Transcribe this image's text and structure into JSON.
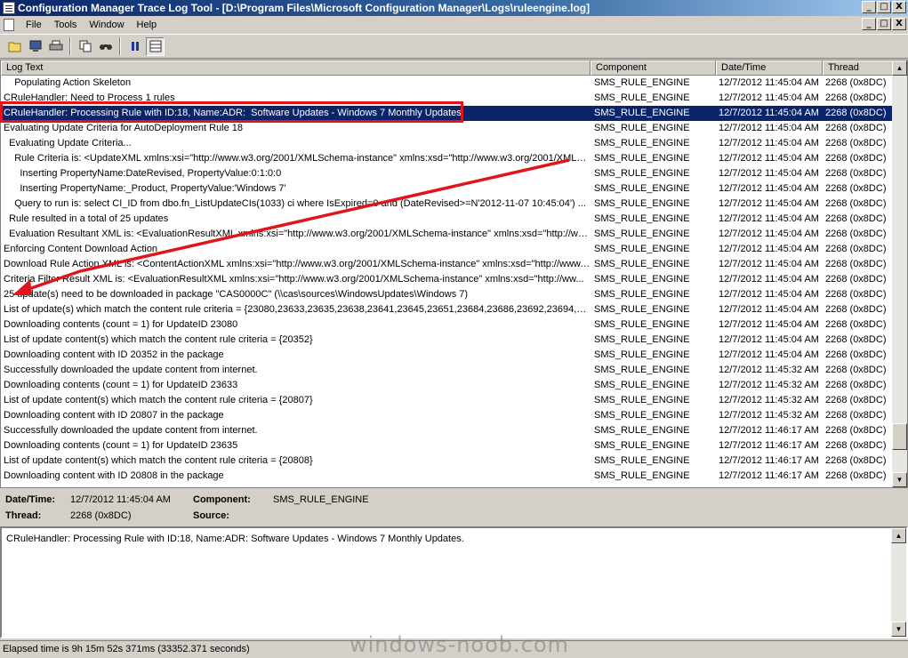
{
  "window": {
    "title": "Configuration Manager Trace Log Tool - [D:\\Program Files\\Microsoft Configuration Manager\\Logs\\ruleengine.log]",
    "minimize": "_",
    "maximize": "□",
    "close": "X"
  },
  "menu": {
    "items": [
      "File",
      "Tools",
      "Window",
      "Help"
    ]
  },
  "columns": {
    "log_text": "Log Text",
    "component": "Component",
    "datetime": "Date/Time",
    "thread": "Thread"
  },
  "rows": [
    {
      "text": "    Populating Action Skeleton",
      "component": "SMS_RULE_ENGINE",
      "datetime": "12/7/2012 11:45:04 AM",
      "thread": "2268 (0x8DC)"
    },
    {
      "text": "CRuleHandler: Need to Process 1 rules",
      "component": "SMS_RULE_ENGINE",
      "datetime": "12/7/2012 11:45:04 AM",
      "thread": "2268 (0x8DC)"
    },
    {
      "text": "CRuleHandler: Processing Rule with ID:18, Name:ADR:  Software Updates - Windows 7 Monthly Updates.",
      "component": "SMS_RULE_ENGINE",
      "datetime": "12/7/2012 11:45:04 AM",
      "thread": "2268 (0x8DC)",
      "selected": true
    },
    {
      "text": "Evaluating Update Criteria for AutoDeployment Rule 18",
      "component": "SMS_RULE_ENGINE",
      "datetime": "12/7/2012 11:45:04 AM",
      "thread": "2268 (0x8DC)"
    },
    {
      "text": "  Evaluating Update Criteria...",
      "component": "SMS_RULE_ENGINE",
      "datetime": "12/7/2012 11:45:04 AM",
      "thread": "2268 (0x8DC)"
    },
    {
      "text": "    Rule Criteria is: <UpdateXML xmlns:xsi=\"http://www.w3.org/2001/XMLSchema-instance\" xmlns:xsd=\"http://www.w3.org/2001/XMLS...",
      "component": "SMS_RULE_ENGINE",
      "datetime": "12/7/2012 11:45:04 AM",
      "thread": "2268 (0x8DC)"
    },
    {
      "text": "      Inserting PropertyName:DateRevised, PropertyValue:0:1:0:0",
      "component": "SMS_RULE_ENGINE",
      "datetime": "12/7/2012 11:45:04 AM",
      "thread": "2268 (0x8DC)"
    },
    {
      "text": "      Inserting PropertyName:_Product, PropertyValue:'Windows 7'",
      "component": "SMS_RULE_ENGINE",
      "datetime": "12/7/2012 11:45:04 AM",
      "thread": "2268 (0x8DC)"
    },
    {
      "text": "    Query to run is: select CI_ID from dbo.fn_ListUpdateCIs(1033) ci where IsExpired=0 and (DateRevised>=N'2012-11-07 10:45:04') ...",
      "component": "SMS_RULE_ENGINE",
      "datetime": "12/7/2012 11:45:04 AM",
      "thread": "2268 (0x8DC)"
    },
    {
      "text": "  Rule resulted in a total of 25 updates",
      "component": "SMS_RULE_ENGINE",
      "datetime": "12/7/2012 11:45:04 AM",
      "thread": "2268 (0x8DC)"
    },
    {
      "text": "  Evaluation Resultant XML is: <EvaluationResultXML xmlns:xsi=\"http://www.w3.org/2001/XMLSchema-instance\" xmlns:xsd=\"http://ww...",
      "component": "SMS_RULE_ENGINE",
      "datetime": "12/7/2012 11:45:04 AM",
      "thread": "2268 (0x8DC)"
    },
    {
      "text": "Enforcing Content Download Action",
      "component": "SMS_RULE_ENGINE",
      "datetime": "12/7/2012 11:45:04 AM",
      "thread": "2268 (0x8DC)"
    },
    {
      "text": "Download Rule Action XML is: <ContentActionXML xmlns:xsi=\"http://www.w3.org/2001/XMLSchema-instance\" xmlns:xsd=\"http://www.w...",
      "component": "SMS_RULE_ENGINE",
      "datetime": "12/7/2012 11:45:04 AM",
      "thread": "2268 (0x8DC)"
    },
    {
      "text": "Criteria Filter Result XML is: <EvaluationResultXML xmlns:xsi=\"http://www.w3.org/2001/XMLSchema-instance\" xmlns:xsd=\"http://ww...",
      "component": "SMS_RULE_ENGINE",
      "datetime": "12/7/2012 11:45:04 AM",
      "thread": "2268 (0x8DC)"
    },
    {
      "text": "25 update(s) need to be downloaded in package \"CAS0000C\" (\\\\cas\\sources\\WindowsUpdates\\Windows 7)",
      "component": "SMS_RULE_ENGINE",
      "datetime": "12/7/2012 11:45:04 AM",
      "thread": "2268 (0x8DC)"
    },
    {
      "text": "List of update(s) which match the content rule criteria = {23080,23633,23635,23638,23641,23645,23651,23684,23686,23692,23694,237...",
      "component": "SMS_RULE_ENGINE",
      "datetime": "12/7/2012 11:45:04 AM",
      "thread": "2268 (0x8DC)"
    },
    {
      "text": "Downloading contents (count = 1) for UpdateID 23080",
      "component": "SMS_RULE_ENGINE",
      "datetime": "12/7/2012 11:45:04 AM",
      "thread": "2268 (0x8DC)"
    },
    {
      "text": "List of update content(s) which match the content rule criteria = {20352}",
      "component": "SMS_RULE_ENGINE",
      "datetime": "12/7/2012 11:45:04 AM",
      "thread": "2268 (0x8DC)"
    },
    {
      "text": "Downloading content with ID 20352 in the package",
      "component": "SMS_RULE_ENGINE",
      "datetime": "12/7/2012 11:45:04 AM",
      "thread": "2268 (0x8DC)"
    },
    {
      "text": "Successfully downloaded the update content from internet.",
      "component": "SMS_RULE_ENGINE",
      "datetime": "12/7/2012 11:45:32 AM",
      "thread": "2268 (0x8DC)"
    },
    {
      "text": "Downloading contents (count = 1) for UpdateID 23633",
      "component": "SMS_RULE_ENGINE",
      "datetime": "12/7/2012 11:45:32 AM",
      "thread": "2268 (0x8DC)"
    },
    {
      "text": "List of update content(s) which match the content rule criteria = {20807}",
      "component": "SMS_RULE_ENGINE",
      "datetime": "12/7/2012 11:45:32 AM",
      "thread": "2268 (0x8DC)"
    },
    {
      "text": "Downloading content with ID 20807 in the package",
      "component": "SMS_RULE_ENGINE",
      "datetime": "12/7/2012 11:45:32 AM",
      "thread": "2268 (0x8DC)"
    },
    {
      "text": "Successfully downloaded the update content from internet.",
      "component": "SMS_RULE_ENGINE",
      "datetime": "12/7/2012 11:46:17 AM",
      "thread": "2268 (0x8DC)"
    },
    {
      "text": "Downloading contents (count = 1) for UpdateID 23635",
      "component": "SMS_RULE_ENGINE",
      "datetime": "12/7/2012 11:46:17 AM",
      "thread": "2268 (0x8DC)"
    },
    {
      "text": "List of update content(s) which match the content rule criteria = {20808}",
      "component": "SMS_RULE_ENGINE",
      "datetime": "12/7/2012 11:46:17 AM",
      "thread": "2268 (0x8DC)"
    },
    {
      "text": "Downloading content with ID 20808 in the package",
      "component": "SMS_RULE_ENGINE",
      "datetime": "12/7/2012 11:46:17 AM",
      "thread": "2268 (0x8DC)"
    }
  ],
  "details": {
    "datetime_label": "Date/Time:",
    "datetime_value": "12/7/2012 11:45:04 AM",
    "component_label": "Component:",
    "component_value": "SMS_RULE_ENGINE",
    "thread_label": "Thread:",
    "thread_value": "2268 (0x8DC)",
    "source_label": "Source:",
    "source_value": ""
  },
  "message": "CRuleHandler: Processing Rule with ID:18, Name:ADR:  Software Updates - Windows 7 Monthly Updates.",
  "status": "Elapsed time is 9h 15m 52s 371ms (33352.371 seconds)",
  "watermark": "windows-noob.com",
  "colors": {
    "selection": "#0a246a",
    "annotation": "#e0151b",
    "chrome": "#d4d0c8"
  }
}
